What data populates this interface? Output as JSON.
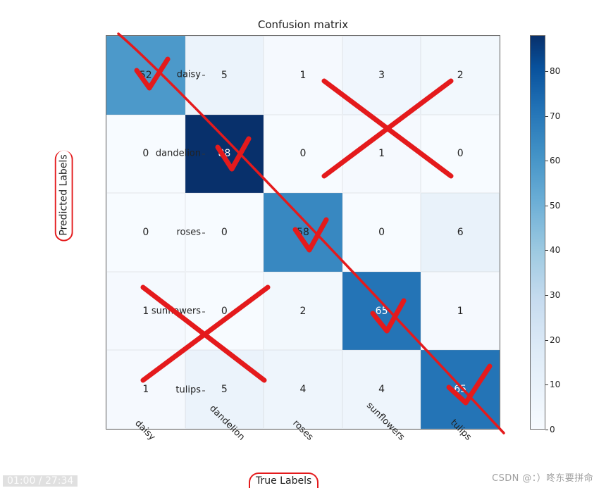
{
  "chart_data": {
    "type": "heatmap",
    "title": "Confusion matrix",
    "xlabel": "True Labels",
    "ylabel": "Predicted Labels",
    "x_categories": [
      "daisy",
      "dandelion",
      "roses",
      "sunflowers",
      "tulips"
    ],
    "y_categories": [
      "daisy",
      "dandelion",
      "roses",
      "sunflowers",
      "tulips"
    ],
    "values": [
      [
        52,
        5,
        1,
        3,
        2
      ],
      [
        0,
        88,
        0,
        1,
        0
      ],
      [
        0,
        0,
        58,
        0,
        6
      ],
      [
        1,
        0,
        2,
        65,
        1
      ],
      [
        1,
        5,
        4,
        4,
        65
      ]
    ],
    "colorbar_ticks": [
      0,
      10,
      20,
      30,
      40,
      50,
      60,
      70,
      80
    ],
    "vmin": 0,
    "vmax": 88
  },
  "watermark": "CSDN @：）咚东要拼命",
  "timestamp": "01:00 / 27:34"
}
